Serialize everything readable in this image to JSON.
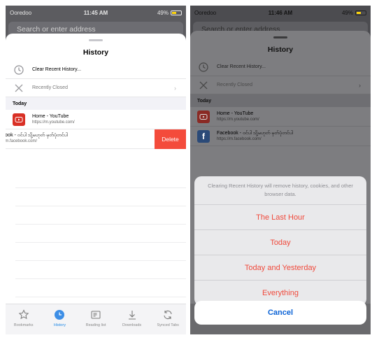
{
  "status_left": {
    "carrier": "Ooredoo",
    "time": "11:45 AM",
    "battery": "49%"
  },
  "status_right": {
    "carrier": "Ooredoo",
    "time": "11:46 AM",
    "battery": "49%"
  },
  "address_bar": {
    "placeholder": "Search or enter address"
  },
  "history": {
    "title": "History",
    "clear_recent": "Clear Recent History...",
    "recently_closed": "Recently Closed",
    "section_today": "Today",
    "items": [
      {
        "title": "Home - YouTube",
        "url": "https://m.youtube.com/"
      },
      {
        "title": "Facebook - ဝင်ပါ သို့မဟုတ် မှတ်ပုံတင်ပါ",
        "url": "https://m.facebook.com/"
      }
    ],
    "swiped_item": {
      "title": "cebook - ဝင်ပါ သို့မဟုတ် မှတ်ပုံတင်ပါ",
      "url": "ps://m.facebook.com/"
    },
    "delete_label": "Delete"
  },
  "tabbar": {
    "tabs": [
      {
        "label": "Bookmarks",
        "icon": "star-icon"
      },
      {
        "label": "History",
        "icon": "clock-icon"
      },
      {
        "label": "Reading list",
        "icon": "reading-list-icon"
      },
      {
        "label": "Downloads",
        "icon": "download-icon"
      },
      {
        "label": "Synced Tabs",
        "icon": "sync-icon"
      }
    ],
    "active": "History"
  },
  "action_sheet": {
    "message": "Clearing Recent History will remove history, cookies, and other browser data.",
    "options": [
      "The Last Hour",
      "Today",
      "Today and Yesterday",
      "Everything"
    ],
    "cancel": "Cancel"
  },
  "colors": {
    "accent": "#1e88e5",
    "destructive": "#f44b3b",
    "action_red": "#f04a3c",
    "cancel_blue": "#0a62d6"
  }
}
